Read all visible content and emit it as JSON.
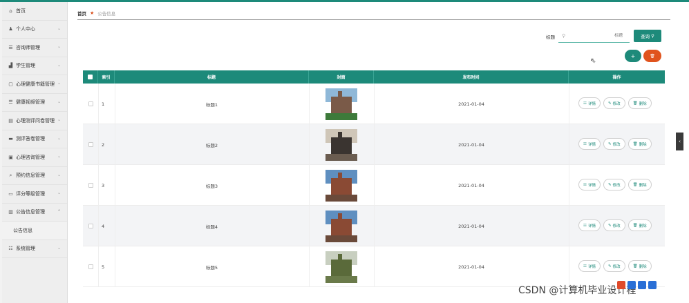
{
  "sidebar": {
    "items": [
      {
        "label": "首页",
        "icon": "home-icon",
        "glyph": "⌂",
        "chevron": false
      },
      {
        "label": "个人中心",
        "icon": "user-icon",
        "glyph": "♟",
        "chevron": true
      },
      {
        "label": "咨询师管理",
        "icon": "list-icon",
        "glyph": "☰",
        "chevron": true
      },
      {
        "label": "学生管理",
        "icon": "chart-icon",
        "glyph": "▟",
        "chevron": true
      },
      {
        "label": "心理健康书籍管理",
        "icon": "book-icon",
        "glyph": "▢",
        "chevron": true
      },
      {
        "label": "健康视频管理",
        "icon": "list-icon",
        "glyph": "☰",
        "chevron": true
      },
      {
        "label": "心理测评问卷管理",
        "icon": "clipboard-icon",
        "glyph": "▤",
        "chevron": true
      },
      {
        "label": "测评答卷管理",
        "icon": "monitor-icon",
        "glyph": "▬",
        "chevron": true
      },
      {
        "label": "心理咨询管理",
        "icon": "chat-icon",
        "glyph": "▣",
        "chevron": true
      },
      {
        "label": "预约信息管理",
        "icon": "search-icon",
        "glyph": "⌕",
        "chevron": true
      },
      {
        "label": "评分等级管理",
        "icon": "card-icon",
        "glyph": "▭",
        "chevron": true
      },
      {
        "label": "公告信息管理",
        "icon": "bar-chart-icon",
        "glyph": "▥",
        "chevron": true,
        "expanded": true
      },
      {
        "label": "公告信息",
        "sub": true
      },
      {
        "label": "系统管理",
        "icon": "settings-icon",
        "glyph": "☷",
        "chevron": true
      }
    ]
  },
  "breadcrumb": {
    "home": "首页",
    "current": "公告信息"
  },
  "search": {
    "label": "标题",
    "placeholder": "标题",
    "button": "查询"
  },
  "actions": {
    "add": "+",
    "delete": "🗑"
  },
  "table": {
    "headers": {
      "index": "索引",
      "title": "标题",
      "cover": "封面",
      "date": "发布时间",
      "ops": "操作"
    },
    "ops": {
      "detail": "详情",
      "edit": "修改",
      "delete": "删除"
    },
    "rows": [
      {
        "index": "1",
        "title": "标题1",
        "date": "2021-01-04"
      },
      {
        "index": "2",
        "title": "标题2",
        "date": "2021-01-04"
      },
      {
        "index": "3",
        "title": "标题3",
        "date": "2021-01-04"
      },
      {
        "index": "4",
        "title": "标题4",
        "date": "2021-01-04"
      },
      {
        "index": "5",
        "title": "标题5",
        "date": "2021-01-04"
      }
    ]
  },
  "watermark": "CSDN @计算机毕业设计程",
  "colors": {
    "primary": "#1d8a7a",
    "danger": "#e0531d"
  }
}
